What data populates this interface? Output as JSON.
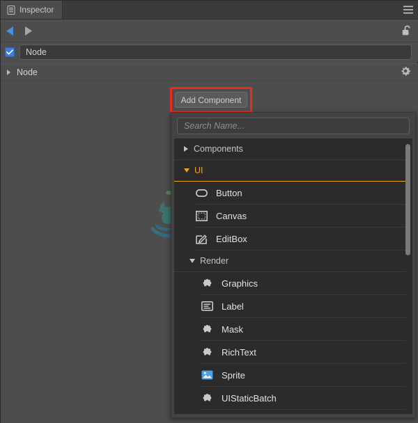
{
  "window": {
    "title": "Inspector",
    "tab_icon": "list-icon",
    "menu_icon": "hamburger-menu-icon"
  },
  "nav": {
    "back_icon": "back-arrow-icon",
    "forward_icon": "forward-arrow-icon",
    "lock_icon": "unlocked-padlock-icon"
  },
  "node": {
    "enabled": true,
    "name_value": "Node",
    "checkbox_icon": "checkmark-icon",
    "component_label": "Node",
    "component_expander_icon": "triangle-right-icon",
    "gear_icon": "gear-icon"
  },
  "toolbar": {
    "add_component_label": "Add Component",
    "highlight_color": "#ee2a1e"
  },
  "dropdown": {
    "search": {
      "placeholder": "Search Name...",
      "value": ""
    },
    "accent_color": "#f0a11e",
    "groups": [
      {
        "label": "Components",
        "expanded": false,
        "icon": "triangle-right-icon",
        "items": []
      },
      {
        "label": "UI",
        "expanded": true,
        "icon": "triangle-down-icon",
        "highlighted": true,
        "items": [
          {
            "label": "Button",
            "icon": "pill-outline-icon"
          },
          {
            "label": "Canvas",
            "icon": "canvas-frame-icon"
          },
          {
            "label": "EditBox",
            "icon": "pencil-square-icon"
          }
        ]
      },
      {
        "label": "Render",
        "expanded": true,
        "icon": "triangle-down-icon",
        "items": [
          {
            "label": "Graphics",
            "icon": "puzzle-piece-icon"
          },
          {
            "label": "Label",
            "icon": "text-lines-icon"
          },
          {
            "label": "Mask",
            "icon": "puzzle-piece-icon"
          },
          {
            "label": "RichText",
            "icon": "puzzle-piece-icon"
          },
          {
            "label": "Sprite",
            "icon": "image-icon"
          },
          {
            "label": "UIStaticBatch",
            "icon": "puzzle-piece-icon"
          }
        ]
      }
    ],
    "scrollbar": "vertical-scrollbar"
  },
  "watermark": {
    "name": "app-logo-watermark"
  }
}
